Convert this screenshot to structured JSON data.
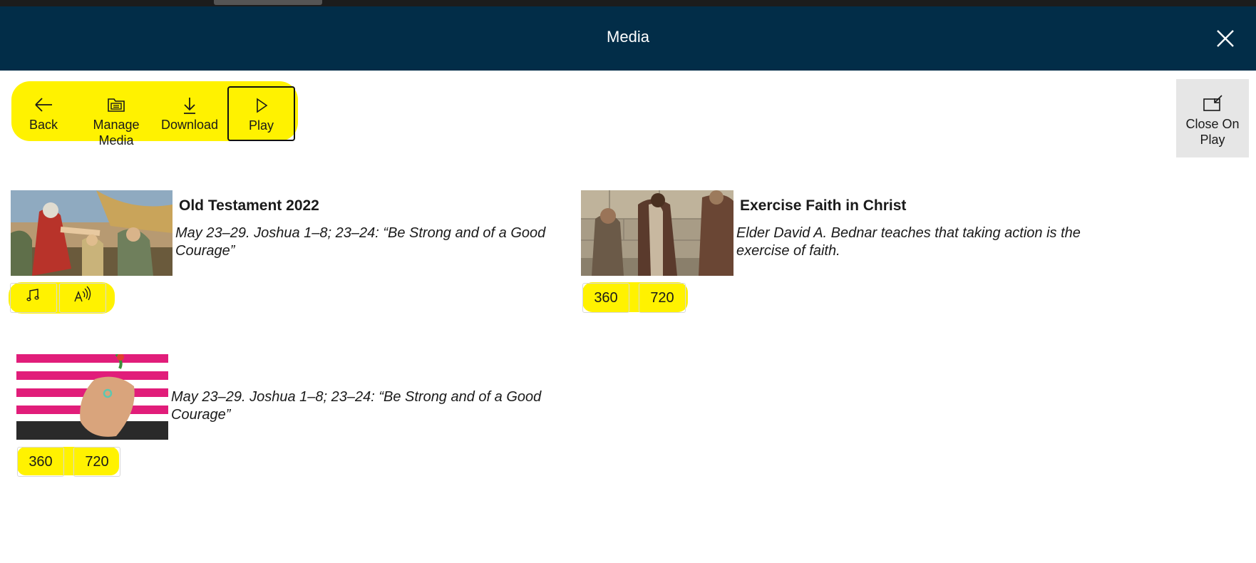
{
  "header": {
    "title": "Media"
  },
  "toolbar": {
    "back_label": "Back",
    "manage_media_label": "Manage Media",
    "download_label": "Download",
    "play_label": "Play",
    "close_on_play_label": "Close On Play"
  },
  "items": [
    {
      "title": "Old Testament 2022",
      "description": "May 23–29. Joshua 1–8; 23–24: “Be Strong and of a Good Courage”",
      "formats": [
        {
          "icon": "music-note-icon"
        },
        {
          "icon": "read-aloud-icon"
        }
      ]
    },
    {
      "title": "Exercise Faith in Christ",
      "description": "Elder David A. Bednar teaches that taking action is the exercise of faith.",
      "formats": [
        {
          "label": "360"
        },
        {
          "label": "720"
        }
      ]
    },
    {
      "title": "",
      "description": "May 23–29. Joshua 1–8; 23–24: “Be Strong and of a Good Courage”",
      "formats": [
        {
          "label": "360"
        },
        {
          "label": "720"
        }
      ]
    }
  ],
  "colors": {
    "header_bg": "#022d48",
    "highlight": "#fff200"
  }
}
